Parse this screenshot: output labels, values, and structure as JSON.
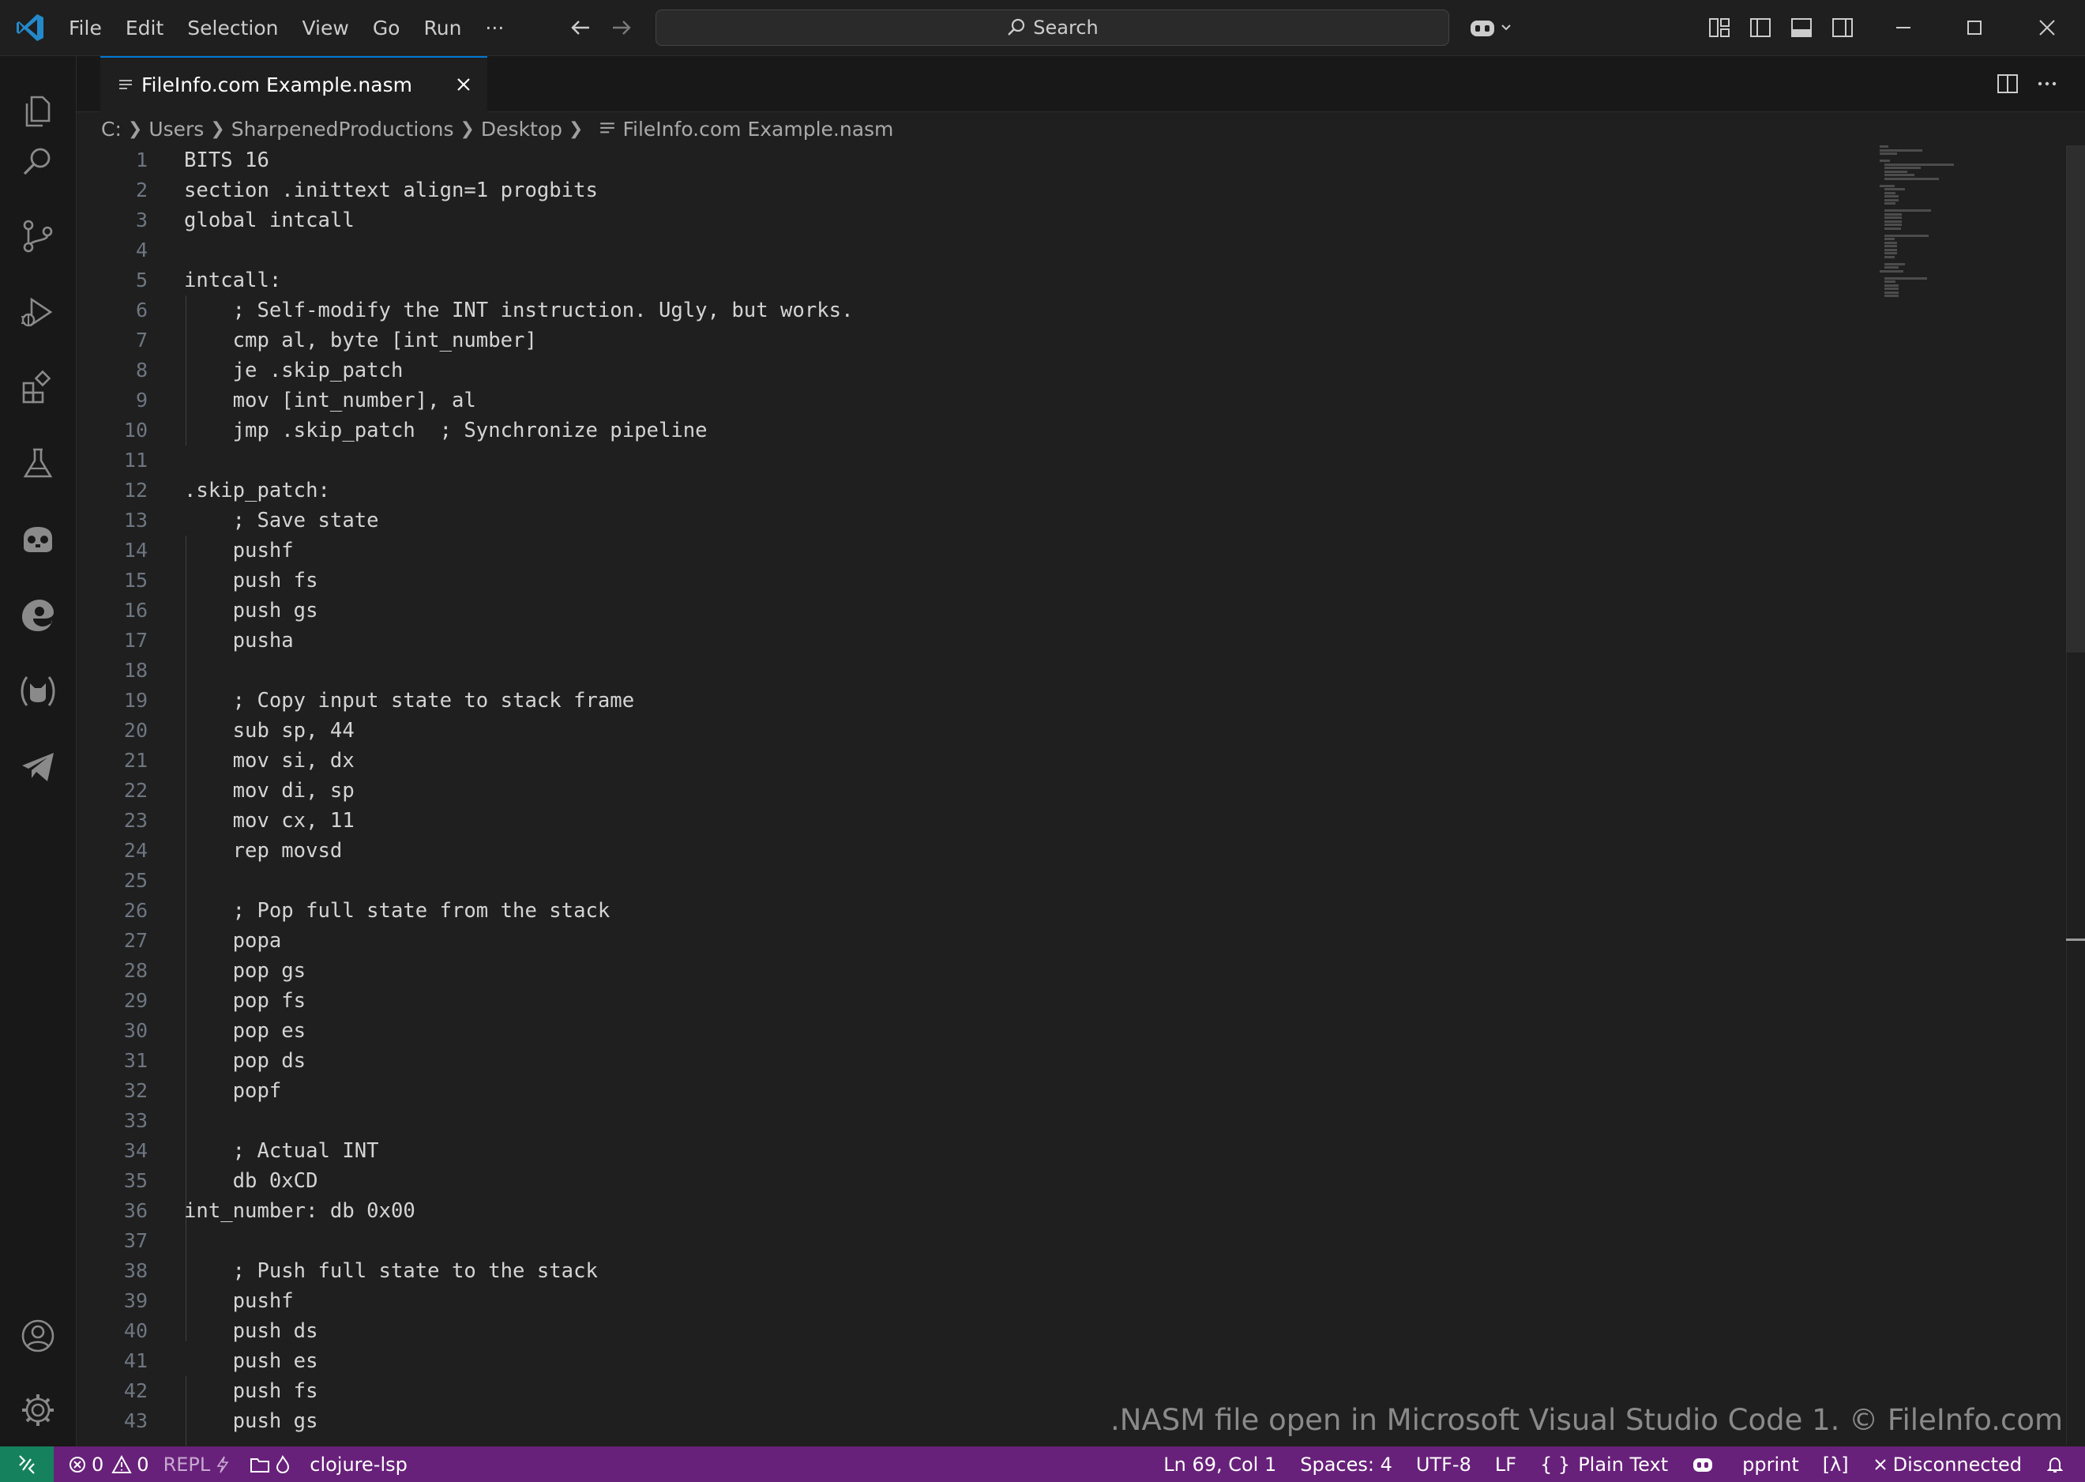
{
  "menu": {
    "file": "File",
    "edit": "Edit",
    "selection": "Selection",
    "view": "View",
    "go": "Go",
    "run": "Run",
    "more": "···"
  },
  "search": {
    "label": "Search"
  },
  "tab": {
    "title": "FileInfo.com Example.nasm"
  },
  "breadcrumb": {
    "drive": "C:",
    "users": "Users",
    "user": "SharpenedProductions",
    "desktop": "Desktop",
    "file": "FileInfo.com Example.nasm"
  },
  "editor": {
    "line_numbers": [
      "1",
      "2",
      "3",
      "4",
      "5",
      "6",
      "7",
      "8",
      "9",
      "10",
      "11",
      "12",
      "13",
      "14",
      "15",
      "16",
      "17",
      "18",
      "19",
      "20",
      "21",
      "22",
      "23",
      "24",
      "25",
      "26",
      "27",
      "28",
      "29",
      "30",
      "31",
      "32",
      "33",
      "34",
      "35",
      "36",
      "37",
      "38",
      "39",
      "40",
      "41",
      "42",
      "43"
    ],
    "lines": [
      "BITS 16",
      "section .inittext align=1 progbits",
      "global intcall",
      "",
      "intcall:",
      "    ; Self-modify the INT instruction. Ugly, but works.",
      "    cmp al, byte [int_number]",
      "    je .skip_patch",
      "    mov [int_number], al",
      "    jmp .skip_patch  ; Synchronize pipeline",
      "",
      ".skip_patch:",
      "    ; Save state",
      "    pushf",
      "    push fs",
      "    push gs",
      "    pusha",
      "",
      "    ; Copy input state to stack frame",
      "    sub sp, 44",
      "    mov si, dx",
      "    mov di, sp",
      "    mov cx, 11",
      "    rep movsd",
      "",
      "    ; Pop full state from the stack",
      "    popa",
      "    pop gs",
      "    pop fs",
      "    pop es",
      "    pop ds",
      "    popf",
      "",
      "    ; Actual INT",
      "    db 0xCD",
      "int_number: db 0x00",
      "",
      "    ; Push full state to the stack",
      "    pushf",
      "    push ds",
      "    push es",
      "    push fs",
      "    push gs"
    ]
  },
  "watermark": ".NASM file open in Microsoft Visual Studio Code 1. © FileInfo.com",
  "status": {
    "errors": "0",
    "warnings": "0",
    "repl": "REPL",
    "lsp": "clojure-lsp",
    "position": "Ln 69, Col 1",
    "spaces": "Spaces: 4",
    "encoding": "UTF-8",
    "eol": "LF",
    "language": "Plain Text",
    "pprint": "pprint",
    "lambda": "[λ]",
    "connection": "Disconnected"
  },
  "colors": {
    "accent": "#0078d4",
    "statusbar": "#68217a",
    "remote": "#16825d"
  }
}
